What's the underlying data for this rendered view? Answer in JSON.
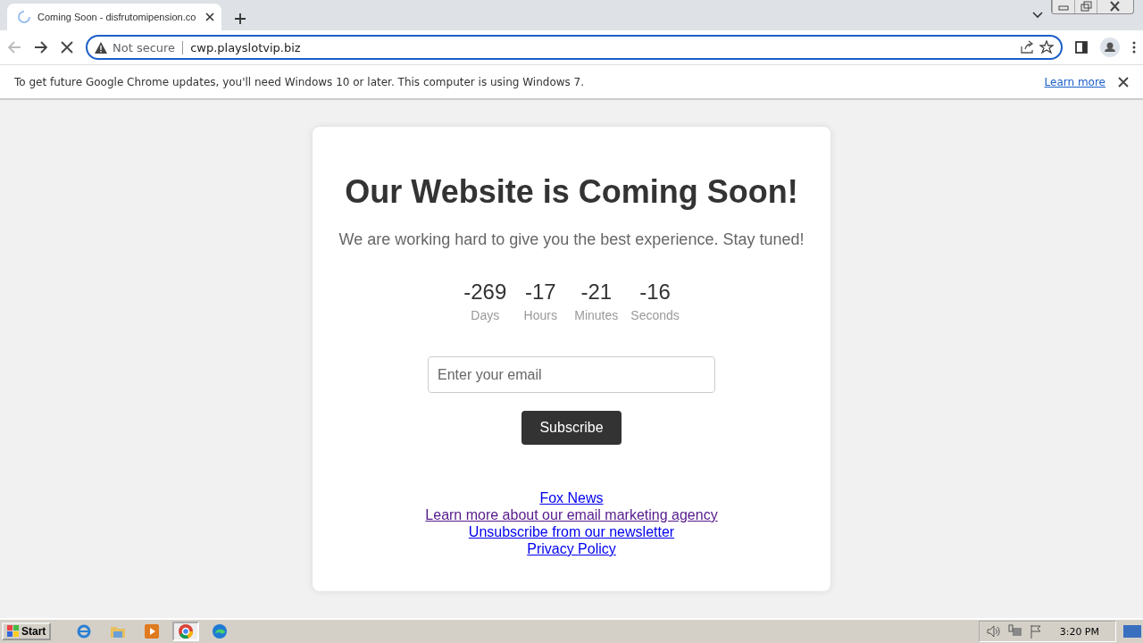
{
  "browser": {
    "tab": {
      "title": "Coming Soon - disfrutomipension.co",
      "loading": true
    },
    "address": {
      "security": "Not secure",
      "url": "cwp.playslotvip.biz"
    },
    "infobar": {
      "message": "To get future Google Chrome updates, you'll need Windows 10 or later. This computer is using Windows 7.",
      "link": "Learn more"
    }
  },
  "page": {
    "heading": "Our Website is Coming Soon!",
    "subheading": "We are working hard to give you the best experience. Stay tuned!",
    "countdown": [
      {
        "value": "-269",
        "unit": "Days"
      },
      {
        "value": "-17",
        "unit": "Hours"
      },
      {
        "value": "-21",
        "unit": "Minutes"
      },
      {
        "value": "-16",
        "unit": "Seconds"
      }
    ],
    "email": {
      "placeholder": "Enter your email"
    },
    "button": "Subscribe",
    "links": [
      {
        "text": "Fox News",
        "visited": false
      },
      {
        "text": "Learn more about our email marketing agency",
        "visited": true
      },
      {
        "text": "Unsubscribe from our newsletter",
        "visited": false
      },
      {
        "text": "Privacy Policy",
        "visited": false
      }
    ]
  },
  "taskbar": {
    "start": "Start",
    "apps": [
      {
        "kind": "ie",
        "selected": false
      },
      {
        "kind": "folder",
        "selected": false
      },
      {
        "kind": "media",
        "selected": false
      },
      {
        "kind": "chrome",
        "selected": true
      },
      {
        "kind": "edge",
        "selected": false
      }
    ],
    "clock": "3:20 PM"
  }
}
